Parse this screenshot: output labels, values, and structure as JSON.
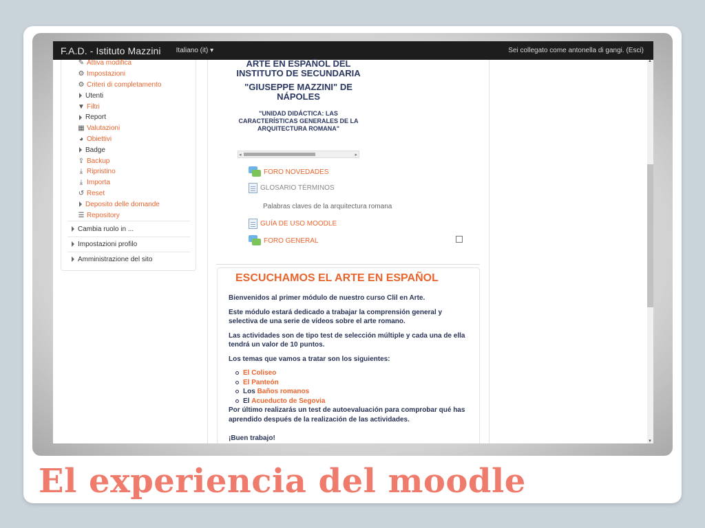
{
  "slide": {
    "title": "El experiencia del moodle"
  },
  "topbar": {
    "brand": "F.A.D. - Istituto Mazzini",
    "language": "Italiano (it)",
    "login_text": "Sei collegato come antonella di gangi. (Esci)"
  },
  "admin_menu": [
    {
      "label": "Attiva modifica",
      "icon": "pencil-icon",
      "link": true
    },
    {
      "label": "Impostazioni",
      "icon": "gear-icon",
      "link": true
    },
    {
      "label": "Criteri di completamento",
      "icon": "gear-icon",
      "link": true
    },
    {
      "label": "Utenti",
      "icon": "triangle-icon",
      "link": false
    },
    {
      "label": "Filtri",
      "icon": "filter-icon",
      "link": true
    },
    {
      "label": "Report",
      "icon": "triangle-icon",
      "link": false
    },
    {
      "label": "Valutazioni",
      "icon": "table-icon",
      "link": true
    },
    {
      "label": "Obiettivi",
      "icon": "target-icon",
      "link": true
    },
    {
      "label": "Badge",
      "icon": "triangle-icon",
      "link": false
    },
    {
      "label": "Backup",
      "icon": "upload-icon",
      "link": true
    },
    {
      "label": "Ripristino",
      "icon": "download-icon",
      "link": true
    },
    {
      "label": "Importa",
      "icon": "import-icon",
      "link": true
    },
    {
      "label": "Reset",
      "icon": "reset-icon",
      "link": true
    },
    {
      "label": "Deposito delle domande",
      "icon": "triangle-icon",
      "link": true
    },
    {
      "label": "Repository",
      "icon": "database-icon",
      "link": true
    }
  ],
  "sections": {
    "change_role": "Cambia ruolo in ...",
    "profile_settings": "Impostazioni profilo",
    "site_admin": "Amministrazione del sito"
  },
  "course": {
    "heading_1": "ARTE EN ESPAÑOL DEL INSTITUTO DE SECUNDARIA",
    "heading_2": "\"GIUSEPPE MAZZINI\" DE NÁPOLES",
    "heading_3": "\"UNIDAD DIDÁCTICA: LAS CARACTERÍSTICAS GENERALES DE LA ARQUITECTURA ROMANA\""
  },
  "activities": {
    "foro_novedades": "FORO NOVEDADES",
    "glosario": "GLOSARIO TÉRMINOS",
    "glosario_desc": "Palabras claves de la arquitectura romana",
    "guia": "GUÍA DE USO MOODLE",
    "foro_general": "FORO GENERAL"
  },
  "topic": {
    "title": "ESCUCHAMOS EL ARTE EN ESPAÑOL",
    "p1": "Bienvenidos al primer módulo de nuestro curso Clil en Arte.",
    "p2": "Este módulo estará dedicado a trabajar la comprensión general y selectiva de una serie de vídeos sobre el arte romano.",
    "p3": "Las actividades son de tipo test de selección múltiple y cada una de ella tendrá un valor de 10 puntos.",
    "p4": "Los temas que vamos a tratar son los siguientes:",
    "items": [
      {
        "prefix": "",
        "link": "El Coliseo",
        "suffix": ""
      },
      {
        "prefix": "",
        "link": "El Panteón",
        "suffix": ""
      },
      {
        "prefix": "Los ",
        "link": "Baños romanos",
        "suffix": ""
      },
      {
        "prefix": "El ",
        "link": "Acueducto de Segovia",
        "suffix": ""
      }
    ],
    "p5": "Por último realizarás un test de autoevaluación para comprobar qué has aprendido después de la realización de las actividades.",
    "p6": "¡Buen trabajo!"
  },
  "colors": {
    "accent": "#e8642d",
    "heading": "#2a3760",
    "title": "#ee7b6c",
    "topbar": "#1d1d1d"
  }
}
